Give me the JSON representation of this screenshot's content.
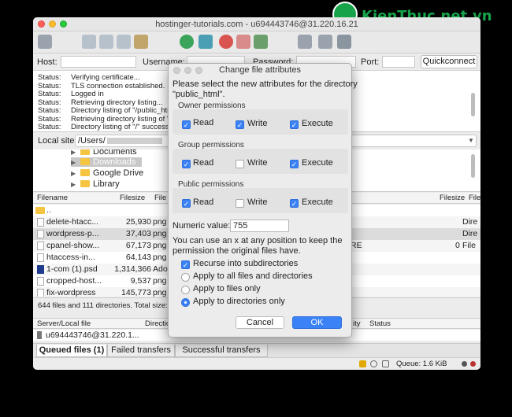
{
  "watermark": {
    "text": "KienThuc.net.vn"
  },
  "window": {
    "title": "hostinger-tutorials.com - u694443746@31.220.16.21"
  },
  "quickconnect": {
    "host_label": "Host:",
    "username_label": "Username:",
    "password_label": "Password:",
    "port_label": "Port:",
    "button": "Quickconnect"
  },
  "log": [
    {
      "k": "Status:",
      "v": "Verifying certificate..."
    },
    {
      "k": "Status:",
      "v": "TLS connection established."
    },
    {
      "k": "Status:",
      "v": "Logged in"
    },
    {
      "k": "Status:",
      "v": "Retrieving directory listing..."
    },
    {
      "k": "Status:",
      "v": "Directory listing of \"/public_htm"
    },
    {
      "k": "Status:",
      "v": "Retrieving directory listing of \"/"
    },
    {
      "k": "Status:",
      "v": "Directory listing of \"/\" successf"
    }
  ],
  "local_site": {
    "label": "Local site:",
    "path": "/Users/"
  },
  "tree": [
    {
      "label": "Documents",
      "selected": false
    },
    {
      "label": "Downloads",
      "selected": true
    },
    {
      "label": "Google Drive",
      "selected": false
    },
    {
      "label": "Library",
      "selected": false
    }
  ],
  "file_headers": {
    "filename": "Filename",
    "filesize": "Filesize",
    "filetype": "File",
    "remote_filesize": "Filesize",
    "remote_filetype": "File"
  },
  "files": [
    {
      "name": "..",
      "size": "",
      "type": "",
      "r1": "",
      "r2": ""
    },
    {
      "name": "delete-htacc...",
      "size": "25,930",
      "type": "png",
      "r1": "Dire",
      "r2": ""
    },
    {
      "name": "wordpress-p...",
      "size": "37,403",
      "type": "png",
      "r1": "Dire",
      "r2": ""
    },
    {
      "name": "cpanel-show...",
      "size": "67,173",
      "type": "png",
      "r1": "File",
      "r2": "0"
    },
    {
      "name": "htaccess-in...",
      "size": "64,143",
      "type": "png",
      "r1": "",
      "r2": ""
    },
    {
      "name": "1-com (1).psd",
      "size": "1,314,366",
      "type": "Ado",
      "r1": "",
      "r2": ""
    },
    {
      "name": "cropped-host...",
      "size": "9,537",
      "type": "png",
      "r1": "",
      "r2": ""
    },
    {
      "name": "fix-wordpress",
      "size": "145,773",
      "type": "png",
      "r1": "",
      "r2": ""
    }
  ],
  "remote_file_text": "RE",
  "files_status": "644 files and 111 directories. Total size: 1,",
  "queue_headers": {
    "server": "Server/Local file",
    "direction": "Directio",
    "priority": "ity",
    "status": "Status"
  },
  "queue_row": "u694443746@31.220.1...",
  "queue_tabs": [
    "Queued files (1)",
    "Failed transfers",
    "Successful transfers"
  ],
  "statusbar": {
    "queue": "Queue: 1.6 KiB"
  },
  "dialog": {
    "title": "Change file attributes",
    "intro_line1": "Please select the new attributes for the directory",
    "intro_line2": "\"public_html\".",
    "groups": [
      {
        "label": "Owner permissions",
        "read": "Read",
        "write": "Write",
        "execute": "Execute",
        "read_on": true,
        "write_on": true,
        "execute_on": true
      },
      {
        "label": "Group permissions",
        "read": "Read",
        "write": "Write",
        "execute": "Execute",
        "read_on": true,
        "write_on": false,
        "execute_on": true
      },
      {
        "label": "Public permissions",
        "read": "Read",
        "write": "Write",
        "execute": "Execute",
        "read_on": true,
        "write_on": false,
        "execute_on": true
      }
    ],
    "numeric_label": "Numeric value:",
    "numeric_value": "755",
    "hint_line1": "You can use an x at any position to keep the",
    "hint_line2": "permission the original files have.",
    "recurse_label": "Recurse into subdirectories",
    "radio_all": "Apply to all files and directories",
    "radio_files": "Apply to files only",
    "radio_dirs": "Apply to directories only",
    "selected_radio": "dirs",
    "cancel": "Cancel",
    "ok": "OK",
    "accent": "#3b82f6"
  }
}
